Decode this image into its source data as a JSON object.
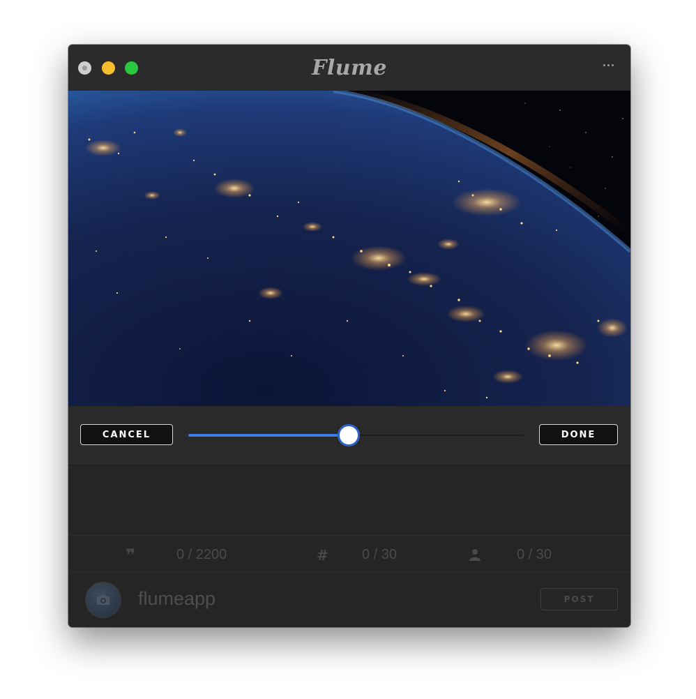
{
  "app": {
    "title": "Flume"
  },
  "editor": {
    "cancel_label": "CANCEL",
    "done_label": "DONE",
    "slider_value": 0.48,
    "accent_color": "#3c7be0"
  },
  "counters": {
    "caption": {
      "icon": "quote-icon",
      "glyph": "❞",
      "value": "0 / 2200"
    },
    "hashtags": {
      "icon": "hashtag-icon",
      "glyph": "#",
      "value": "0 / 30"
    },
    "mentions": {
      "icon": "person-icon",
      "value": "0 / 30"
    }
  },
  "account": {
    "username": "flumeapp",
    "post_label": "POST"
  },
  "traffic_colors": {
    "close": "#cfcfcf",
    "minimize": "#f6be2f",
    "maximize": "#2ac840"
  }
}
